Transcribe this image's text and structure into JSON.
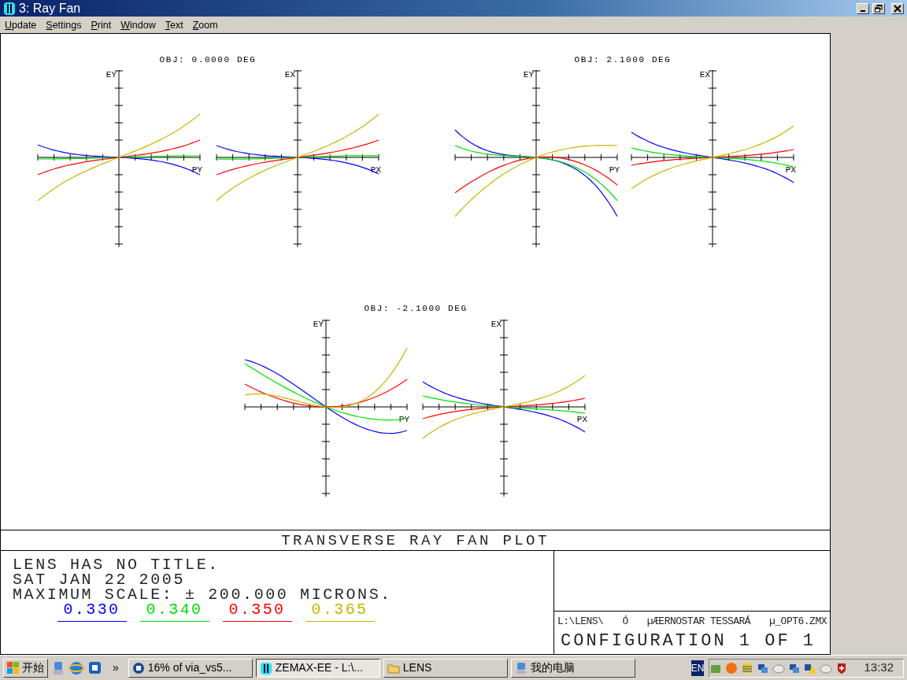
{
  "window": {
    "title": "3: Ray Fan"
  },
  "menu": [
    {
      "label": "Update"
    },
    {
      "label": "Settings"
    },
    {
      "label": "Print"
    },
    {
      "label": "Window"
    },
    {
      "label": "Text"
    },
    {
      "label": "Zoom"
    }
  ],
  "plots": [
    {
      "title": "OBJ: 0.0000 DEG",
      "fans": [
        {
          "y_label": "EY",
          "x_label": "PY"
        },
        {
          "y_label": "EX",
          "x_label": "PX"
        }
      ]
    },
    {
      "title": "OBJ: 2.1000 DEG",
      "fans": [
        {
          "y_label": "EY",
          "x_label": "PY"
        },
        {
          "y_label": "EX",
          "x_label": "PX"
        }
      ]
    },
    {
      "title": "OBJ: -2.1000 DEG",
      "fans": [
        {
          "y_label": "EY",
          "x_label": "PY"
        },
        {
          "y_label": "EX",
          "x_label": "PX"
        }
      ]
    }
  ],
  "plot_title": "TRANSVERSE RAY FAN PLOT",
  "info_lines": [
    "LENS HAS NO TITLE.",
    "SAT JAN 22 2005",
    "MAXIMUM SCALE: ± 200.000 MICRONS."
  ],
  "wavelengths": [
    {
      "label": "0.330",
      "color": "#0000ff"
    },
    {
      "label": "0.340",
      "color": "#00e000"
    },
    {
      "label": "0.350",
      "color": "#ff0000"
    },
    {
      "label": "0.365",
      "color": "#c8b400"
    }
  ],
  "file_info": {
    "path": "L:\\LENS\\",
    "column_2": "Ó",
    "lens_name": "µÆERNOSTAR TESSARÁ",
    "file_name": "µ_OPT6.ZMX"
  },
  "configuration": "CONFIGURATION 1 OF 1",
  "taskbar": {
    "start": "开始",
    "more": "»",
    "tasks": [
      {
        "label": "16% of via_vs5...",
        "selected": false
      },
      {
        "label": "ZEMAX-EE - L:\\...",
        "selected": true
      },
      {
        "label": "LENS",
        "selected": false
      },
      {
        "label": "我的电脑",
        "selected": false
      }
    ],
    "language": "EN",
    "clock": "13:32"
  }
}
